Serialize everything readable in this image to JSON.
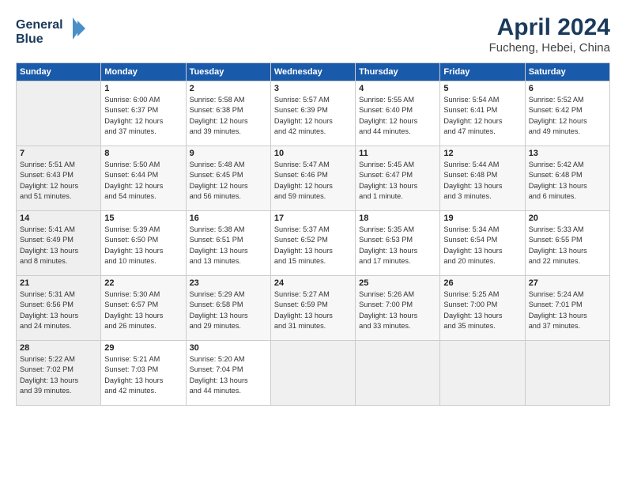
{
  "header": {
    "logo_line1": "General",
    "logo_line2": "Blue",
    "title": "April 2024",
    "subtitle": "Fucheng, Hebei, China"
  },
  "columns": [
    "Sunday",
    "Monday",
    "Tuesday",
    "Wednesday",
    "Thursday",
    "Friday",
    "Saturday"
  ],
  "weeks": [
    [
      {
        "day": "",
        "info": ""
      },
      {
        "day": "1",
        "info": "Sunrise: 6:00 AM\nSunset: 6:37 PM\nDaylight: 12 hours\nand 37 minutes."
      },
      {
        "day": "2",
        "info": "Sunrise: 5:58 AM\nSunset: 6:38 PM\nDaylight: 12 hours\nand 39 minutes."
      },
      {
        "day": "3",
        "info": "Sunrise: 5:57 AM\nSunset: 6:39 PM\nDaylight: 12 hours\nand 42 minutes."
      },
      {
        "day": "4",
        "info": "Sunrise: 5:55 AM\nSunset: 6:40 PM\nDaylight: 12 hours\nand 44 minutes."
      },
      {
        "day": "5",
        "info": "Sunrise: 5:54 AM\nSunset: 6:41 PM\nDaylight: 12 hours\nand 47 minutes."
      },
      {
        "day": "6",
        "info": "Sunrise: 5:52 AM\nSunset: 6:42 PM\nDaylight: 12 hours\nand 49 minutes."
      }
    ],
    [
      {
        "day": "7",
        "info": "Sunrise: 5:51 AM\nSunset: 6:43 PM\nDaylight: 12 hours\nand 51 minutes."
      },
      {
        "day": "8",
        "info": "Sunrise: 5:50 AM\nSunset: 6:44 PM\nDaylight: 12 hours\nand 54 minutes."
      },
      {
        "day": "9",
        "info": "Sunrise: 5:48 AM\nSunset: 6:45 PM\nDaylight: 12 hours\nand 56 minutes."
      },
      {
        "day": "10",
        "info": "Sunrise: 5:47 AM\nSunset: 6:46 PM\nDaylight: 12 hours\nand 59 minutes."
      },
      {
        "day": "11",
        "info": "Sunrise: 5:45 AM\nSunset: 6:47 PM\nDaylight: 13 hours\nand 1 minute."
      },
      {
        "day": "12",
        "info": "Sunrise: 5:44 AM\nSunset: 6:48 PM\nDaylight: 13 hours\nand 3 minutes."
      },
      {
        "day": "13",
        "info": "Sunrise: 5:42 AM\nSunset: 6:48 PM\nDaylight: 13 hours\nand 6 minutes."
      }
    ],
    [
      {
        "day": "14",
        "info": "Sunrise: 5:41 AM\nSunset: 6:49 PM\nDaylight: 13 hours\nand 8 minutes."
      },
      {
        "day": "15",
        "info": "Sunrise: 5:39 AM\nSunset: 6:50 PM\nDaylight: 13 hours\nand 10 minutes."
      },
      {
        "day": "16",
        "info": "Sunrise: 5:38 AM\nSunset: 6:51 PM\nDaylight: 13 hours\nand 13 minutes."
      },
      {
        "day": "17",
        "info": "Sunrise: 5:37 AM\nSunset: 6:52 PM\nDaylight: 13 hours\nand 15 minutes."
      },
      {
        "day": "18",
        "info": "Sunrise: 5:35 AM\nSunset: 6:53 PM\nDaylight: 13 hours\nand 17 minutes."
      },
      {
        "day": "19",
        "info": "Sunrise: 5:34 AM\nSunset: 6:54 PM\nDaylight: 13 hours\nand 20 minutes."
      },
      {
        "day": "20",
        "info": "Sunrise: 5:33 AM\nSunset: 6:55 PM\nDaylight: 13 hours\nand 22 minutes."
      }
    ],
    [
      {
        "day": "21",
        "info": "Sunrise: 5:31 AM\nSunset: 6:56 PM\nDaylight: 13 hours\nand 24 minutes."
      },
      {
        "day": "22",
        "info": "Sunrise: 5:30 AM\nSunset: 6:57 PM\nDaylight: 13 hours\nand 26 minutes."
      },
      {
        "day": "23",
        "info": "Sunrise: 5:29 AM\nSunset: 6:58 PM\nDaylight: 13 hours\nand 29 minutes."
      },
      {
        "day": "24",
        "info": "Sunrise: 5:27 AM\nSunset: 6:59 PM\nDaylight: 13 hours\nand 31 minutes."
      },
      {
        "day": "25",
        "info": "Sunrise: 5:26 AM\nSunset: 7:00 PM\nDaylight: 13 hours\nand 33 minutes."
      },
      {
        "day": "26",
        "info": "Sunrise: 5:25 AM\nSunset: 7:00 PM\nDaylight: 13 hours\nand 35 minutes."
      },
      {
        "day": "27",
        "info": "Sunrise: 5:24 AM\nSunset: 7:01 PM\nDaylight: 13 hours\nand 37 minutes."
      }
    ],
    [
      {
        "day": "28",
        "info": "Sunrise: 5:22 AM\nSunset: 7:02 PM\nDaylight: 13 hours\nand 39 minutes."
      },
      {
        "day": "29",
        "info": "Sunrise: 5:21 AM\nSunset: 7:03 PM\nDaylight: 13 hours\nand 42 minutes."
      },
      {
        "day": "30",
        "info": "Sunrise: 5:20 AM\nSunset: 7:04 PM\nDaylight: 13 hours\nand 44 minutes."
      },
      {
        "day": "",
        "info": ""
      },
      {
        "day": "",
        "info": ""
      },
      {
        "day": "",
        "info": ""
      },
      {
        "day": "",
        "info": ""
      }
    ]
  ]
}
